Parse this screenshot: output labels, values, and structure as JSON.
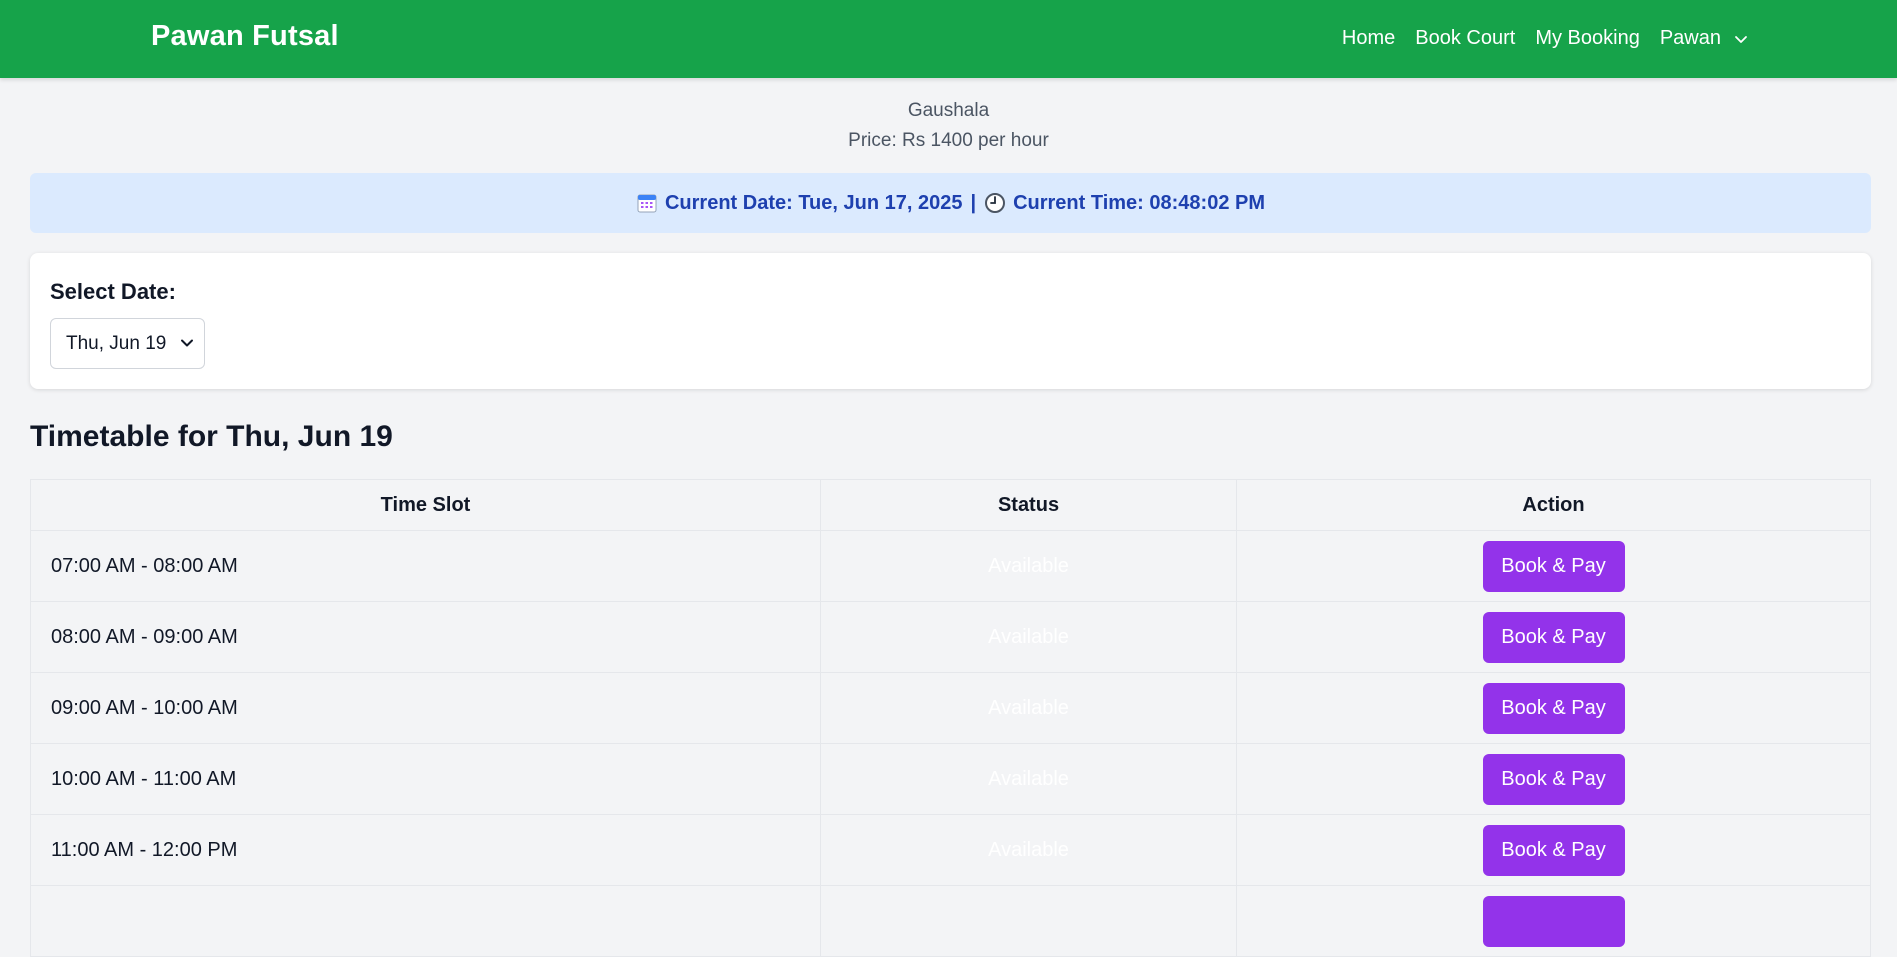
{
  "navbar": {
    "brand": "Pawan Futsal",
    "links": [
      "Home",
      "Book Court",
      "My Booking"
    ],
    "user": "Pawan",
    "bg_color": "#16a34a"
  },
  "venue": {
    "location": "Gaushala",
    "price": "Price: Rs 1400 per hour"
  },
  "datetime": {
    "date_text": "Current Date: Tue, Jun 17, 2025",
    "separator": "|",
    "time_text": "Current Time: 08:48:02 PM",
    "date_icon": "calendar-icon",
    "time_icon": "clock-icon"
  },
  "date_picker": {
    "label": "Select Date:",
    "selected": "Thu, Jun 19"
  },
  "timetable": {
    "title": "Timetable for Thu, Jun 19",
    "headers": [
      "Time Slot",
      "Status",
      "Action"
    ],
    "rows": [
      {
        "slot": "07:00 AM - 08:00 AM",
        "status": "Available",
        "action": "Book & Pay"
      },
      {
        "slot": "08:00 AM - 09:00 AM",
        "status": "Available",
        "action": "Book & Pay"
      },
      {
        "slot": "09:00 AM - 10:00 AM",
        "status": "Available",
        "action": "Book & Pay"
      },
      {
        "slot": "10:00 AM - 11:00 AM",
        "status": "Available",
        "action": "Book & Pay"
      },
      {
        "slot": "11:00 AM - 12:00 PM",
        "status": "Available",
        "action": "Book & Pay"
      },
      {
        "slot": "",
        "status": "",
        "action": ""
      }
    ],
    "available_color": "#22c55e",
    "button_color": "#9333ea"
  }
}
